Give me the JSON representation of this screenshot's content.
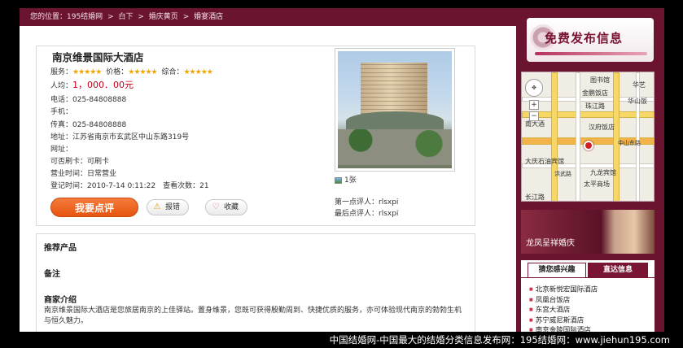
{
  "breadcrumb": [
    "您的位置：195结婚网",
    ">",
    "白下",
    ">",
    "婚庆黄页",
    ">",
    "婚宴酒店"
  ],
  "hotel": {
    "name": "南京维景国际大酒店",
    "ratings": [
      {
        "label": "服务：",
        "stars": "★★★★★"
      },
      {
        "label": "价格：",
        "stars": "★★★★★"
      },
      {
        "label": "综合：",
        "stars": "★★★★★"
      }
    ],
    "price_label": "人均：",
    "price_value": "1，000．00元",
    "phone": "电话：025-84808888",
    "mobile": "手机：",
    "fax": "传真：025-84808888",
    "address": "地址：江苏省南京市玄武区中山东路319号",
    "website": "网址：",
    "card": "可否刷卡：可刷卡",
    "hours": "营业时间：日常营业",
    "register": "登记时间：2010-7-14 0:11:22　查看次数：21"
  },
  "actions": {
    "review": "我要点评",
    "report": "报错",
    "favorite": "收藏"
  },
  "photo": {
    "count": "1张",
    "first_reviewer": "第一点评人：rlsxpi",
    "last_reviewer": "最后点评人：rlsxpi"
  },
  "sections": {
    "products": "推荐产品",
    "notes": "备注",
    "intro_title": "商家介绍",
    "intro_text": "南京维景国际大酒店是您旅居南京的上佳驿站。置身维景，您既可获得殷勤周到、快捷优质的服务，亦可体验现代南京的勃勃生机与恒久魅力。"
  },
  "sidebar": {
    "free_post": "免费发布信息",
    "map_labels": [
      "图书馆",
      "华艺",
      "金鹏饭店",
      "华山饭",
      "珠江路",
      "汉府饭店",
      "南大酒",
      "大庆石油宾馆",
      "九龙宾馆",
      "洪武路",
      "太平商场",
      "长江路",
      "中山东路"
    ],
    "ad_text": "龙凤呈祥婚庆",
    "tab_active": "猜您感兴趣",
    "tab_inactive": "直达信息",
    "list": [
      "北京新悦宏国际酒店",
      "凤凰台饭店",
      "东宫大酒店",
      "苏宁威尼斯酒店",
      "南京金陵国际酒店"
    ]
  },
  "footer": "中国结婚网-中国最大的结婚分类信息发布网：195结婚网：www.jiehun195.com"
}
